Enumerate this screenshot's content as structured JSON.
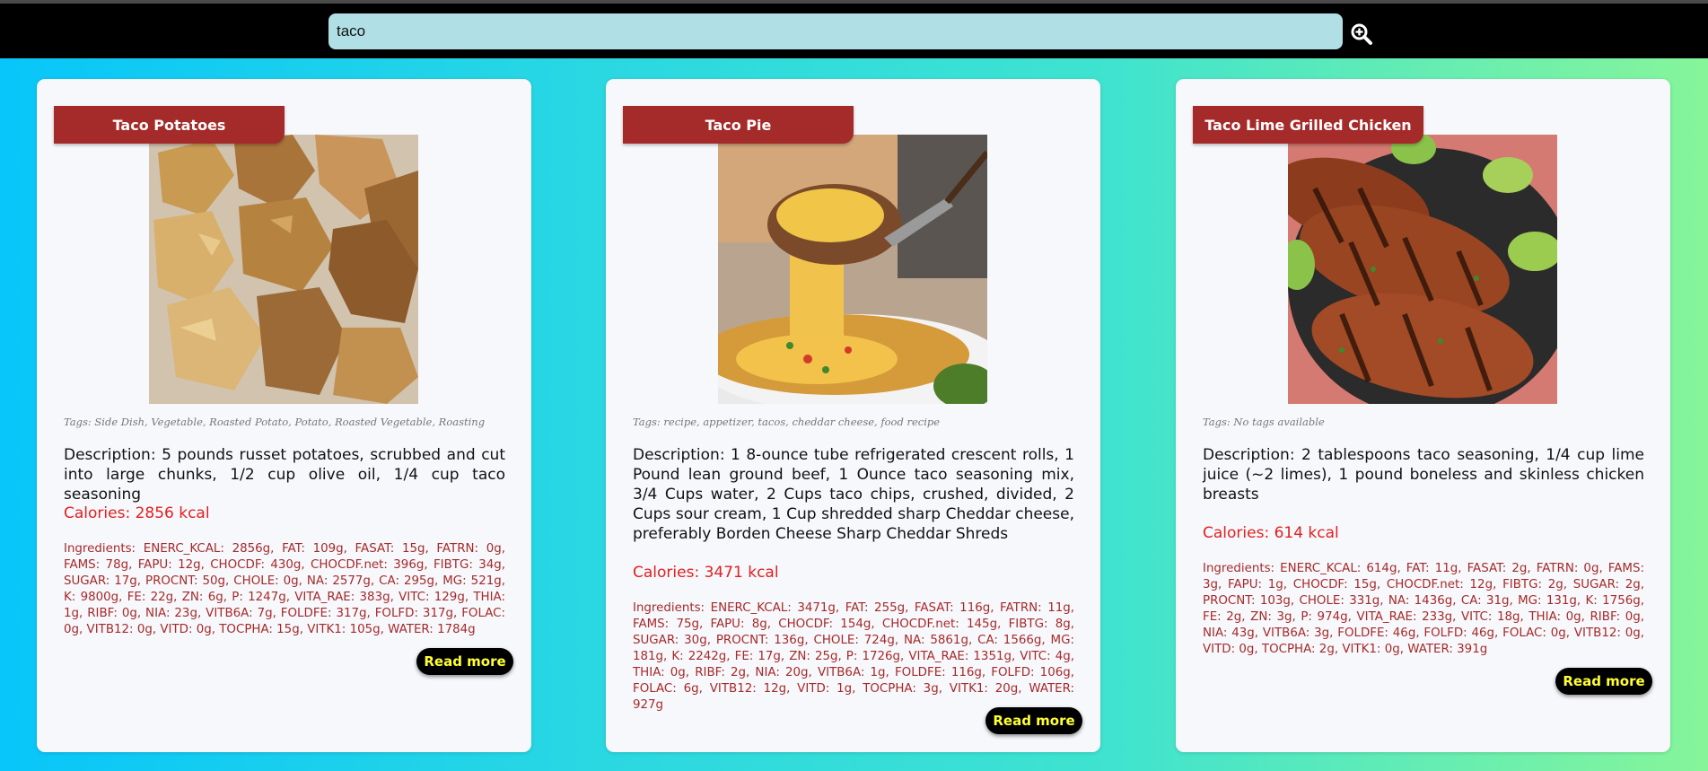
{
  "search": {
    "value": "taco",
    "icon": "zoom-in-icon"
  },
  "recipes": [
    {
      "title": "Taco Potatoes",
      "tags": "Tags: Side Dish, Vegetable, Roasted Potato, Potato, Roasted Vegetable, Roasting",
      "description": "Description: 5 pounds russet potatoes, scrubbed and cut into large chunks, 1/2 cup olive oil, 1/4 cup taco seasoning",
      "calories": "Calories: 2856 kcal",
      "ingredients": "Ingredients: ENERC_KCAL: 2856g, FAT: 109g, FASAT: 15g, FATRN: 0g, FAMS: 78g, FAPU: 12g, CHOCDF: 430g, CHOCDF.net: 396g, FIBTG: 34g, SUGAR: 17g, PROCNT: 50g, CHOLE: 0g, NA: 2577g, CA: 295g, MG: 521g, K: 9800g, FE: 22g, ZN: 6g, P: 1247g, VITA_RAE: 383g, VITC: 129g, THIA: 1g, RIBF: 0g, NIA: 23g, VITB6A: 7g, FOLDFE: 317g, FOLFD: 317g, FOLAC: 0g, VITB12: 0g, VITD: 0g, TOCPHA: 15g, VITK1: 105g, WATER: 1784g",
      "read_more": "Read more"
    },
    {
      "title": "Taco Pie",
      "tags": "Tags: recipe, appetizer, tacos, cheddar cheese, food recipe",
      "description": "Description: 1 8-ounce tube refrigerated crescent rolls, 1 Pound lean ground beef, 1 Ounce taco seasoning mix, 3/4 Cups water, 2 Cups taco chips, crushed, divided, 2 Cups sour cream, 1 Cup shredded sharp Cheddar cheese, preferably Borden Cheese Sharp Cheddar Shreds",
      "calories": "Calories: 3471 kcal",
      "ingredients": "Ingredients: ENERC_KCAL: 3471g, FAT: 255g, FASAT: 116g, FATRN: 11g, FAMS: 75g, FAPU: 8g, CHOCDF: 154g, CHOCDF.net: 145g, FIBTG: 8g, SUGAR: 30g, PROCNT: 136g, CHOLE: 724g, NA: 5861g, CA: 1566g, MG: 181g, K: 2242g, FE: 17g, ZN: 25g, P: 1726g, VITA_RAE: 1351g, VITC: 4g, THIA: 0g, RIBF: 2g, NIA: 20g, VITB6A: 1g, FOLDFE: 116g, FOLFD: 106g, FOLAC: 6g, VITB12: 12g, VITD: 1g, TOCPHA: 3g, VITK1: 20g, WATER: 927g",
      "read_more": "Read more"
    },
    {
      "title": "Taco Lime Grilled Chicken",
      "tags": "Tags: No tags available",
      "description": "Description: 2 tablespoons taco seasoning, 1/4 cup lime juice (~2 limes), 1 pound boneless and skinless chicken breasts",
      "calories": "Calories: 614 kcal",
      "ingredients": "Ingredients: ENERC_KCAL: 614g, FAT: 11g, FASAT: 2g, FATRN: 0g, FAMS: 3g, FAPU: 1g, CHOCDF: 15g, CHOCDF.net: 12g, FIBTG: 2g, SUGAR: 2g, PROCNT: 103g, CHOLE: 331g, NA: 1436g, CA: 31g, MG: 131g, K: 1756g, FE: 2g, ZN: 3g, P: 974g, VITA_RAE: 233g, VITC: 18g, THIA: 0g, RIBF: 0g, NIA: 43g, VITB6A: 3g, FOLDFE: 46g, FOLFD: 46g, FOLAC: 0g, VITB12: 0g, VITD: 0g, TOCPHA: 2g, VITK1: 0g, WATER: 391g",
      "read_more": "Read more"
    }
  ],
  "colors": {
    "title_bg": "#a52a2a",
    "calories": "#e02020",
    "ingredients": "#a52a2a",
    "button_text": "#ffff33",
    "search_bg": "#b0e0e6"
  }
}
